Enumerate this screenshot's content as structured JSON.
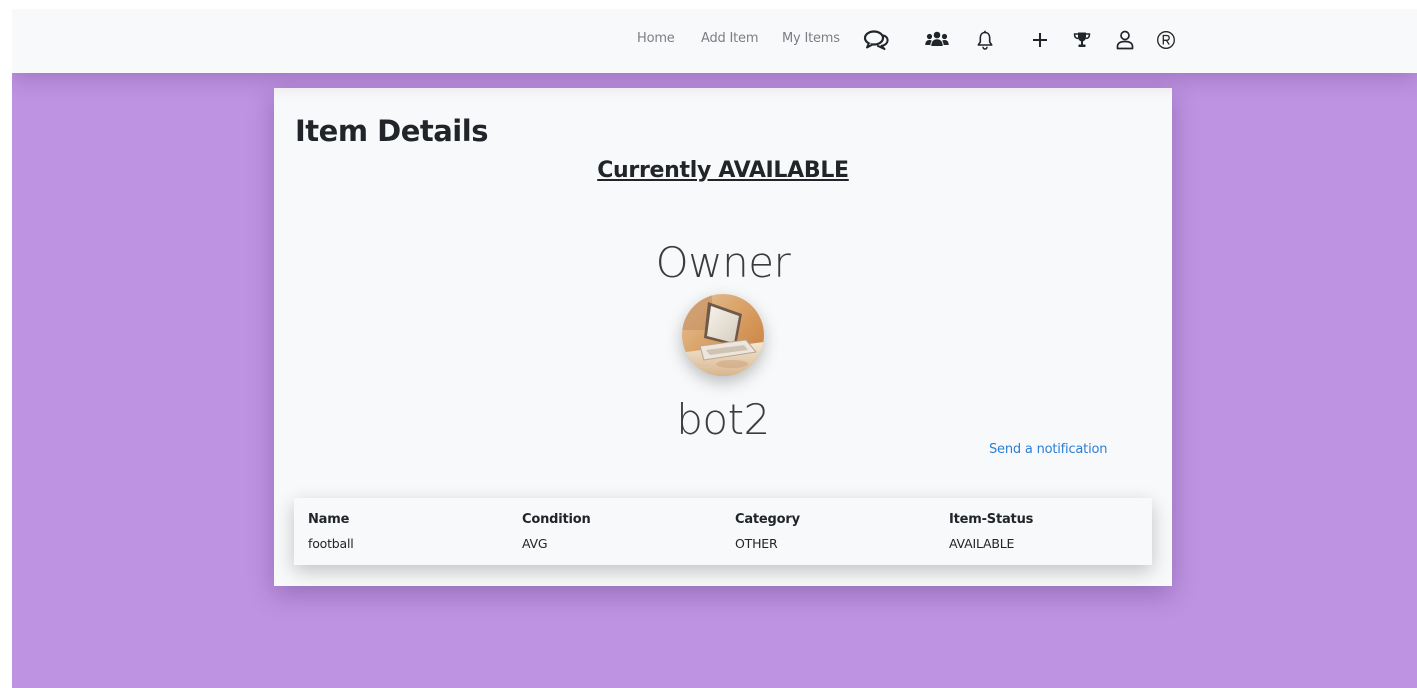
{
  "nav": {
    "links": {
      "home": "Home",
      "add_item": "Add Item",
      "my_items": "My Items"
    },
    "icons": [
      "chat-icon",
      "users-icon",
      "bell-icon",
      "plus-icon",
      "trophy-icon",
      "user-icon",
      "registered-icon"
    ]
  },
  "card": {
    "title": "Item Details",
    "status_heading": "Currently AVAILABLE",
    "owner_label": "Owner",
    "owner_name": "bot2",
    "notify_link": "Send a notification"
  },
  "table": {
    "headers": {
      "name": "Name",
      "condition": "Condition",
      "category": "Category",
      "status": "Item-Status"
    },
    "row": {
      "name": "football",
      "condition": "AVG",
      "category": "OTHER",
      "status": "AVAILABLE"
    }
  },
  "colors": {
    "background": "#be93e2",
    "card": "#f8f9fa",
    "navbar": "#f8f9fa",
    "link": "#2b7fd6",
    "text": "#212529"
  }
}
